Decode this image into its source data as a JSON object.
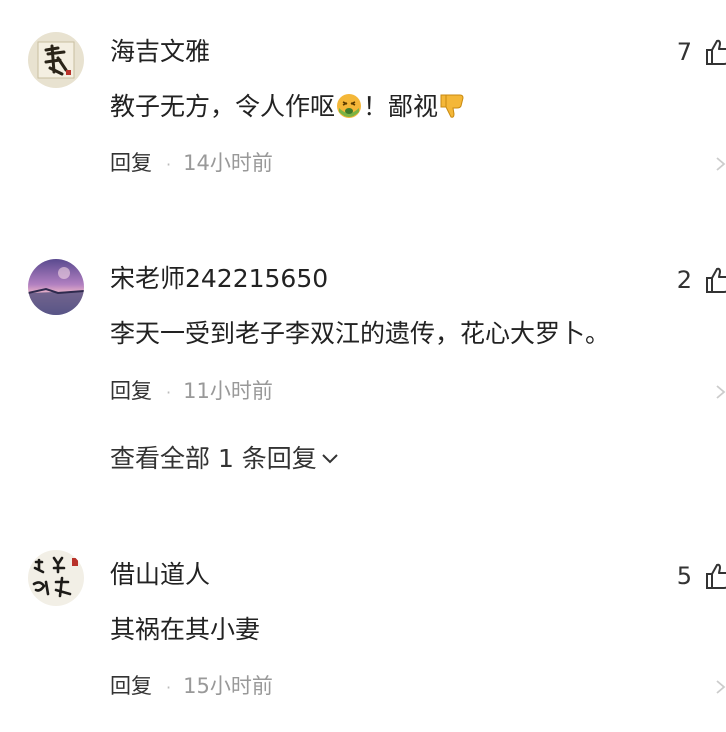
{
  "comments": [
    {
      "username": "海吉文雅",
      "likes": "7",
      "text_part1": "教子无方，令人作呕",
      "text_part2": "！鄙视",
      "emojis": [
        "nauseated-face-emoji",
        "thumbs-down-emoji"
      ],
      "reply_label": "回复",
      "separator": "·",
      "time": "14小时前",
      "avatar": "calligraphy-静-avatar"
    },
    {
      "username": "宋老师242215650",
      "likes": "2",
      "text": "李天一受到老子李双江的遗传，花心大罗卜。",
      "reply_label": "回复",
      "separator": "·",
      "time": "11小时前",
      "avatar": "purple-sunset-landscape-avatar",
      "view_all_replies": "查看全部 1 条回复"
    },
    {
      "username": "借山道人",
      "likes": "5",
      "text": "其祸在其小妻",
      "reply_label": "回复",
      "separator": "·",
      "time": "15小时前",
      "avatar": "calligraphy-seal-avatar"
    }
  ],
  "colors": {
    "text_primary": "#222222",
    "text_secondary": "#999999",
    "separator": "#bbbbbb",
    "background": "#ffffff"
  }
}
